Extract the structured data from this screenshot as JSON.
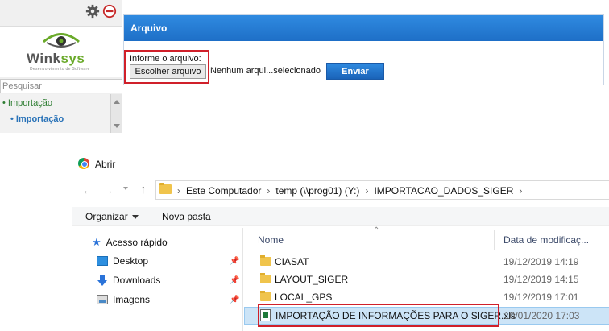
{
  "app": {
    "search_placeholder": "Pesquisar",
    "logo": {
      "word_part1": "Wink",
      "word_part2": "sys",
      "tagline": "Desenvolvimento de Software"
    },
    "menu": [
      {
        "label": "• Importação"
      },
      {
        "label": "• Importação"
      }
    ],
    "panel": {
      "title": "Arquivo",
      "file_label": "Informe o arquivo:",
      "choose_button": "Escolher arquivo",
      "file_status": "Nenhum arqui...selecionado",
      "send_button": "Enviar"
    }
  },
  "dialog": {
    "title": "Abrir",
    "breadcrumbs": [
      "Este Computador",
      "temp (\\\\prog01) (Y:)",
      "IMPORTACAO_DADOS_SIGER"
    ],
    "toolbar": {
      "organize": "Organizar",
      "new_folder": "Nova pasta"
    },
    "nav_pane": [
      {
        "label": "Acesso rápido",
        "icon": "star-icon"
      },
      {
        "label": "Desktop",
        "icon": "desktop-icon"
      },
      {
        "label": "Downloads",
        "icon": "downloads-icon"
      },
      {
        "label": "Imagens",
        "icon": "images-icon"
      }
    ],
    "columns": {
      "name": "Nome",
      "date": "Data de modificaç..."
    },
    "files": [
      {
        "name": "CIASAT",
        "date": "19/12/2019 14:19",
        "type": "folder"
      },
      {
        "name": "LAYOUT_SIGER",
        "date": "19/12/2019 14:15",
        "type": "folder"
      },
      {
        "name": "LOCAL_GPS",
        "date": "19/12/2019 17:01",
        "type": "folder"
      },
      {
        "name": "IMPORTAÇÃO DE INFORMAÇÕES PARA O SIGER.xls",
        "date": "10/01/2020 17:03",
        "type": "xls"
      }
    ]
  },
  "colors": {
    "header_blue": "#1e6fc7",
    "highlight_red": "#d0202a",
    "selected_row": "#cce4f7",
    "menu_green": "#2e7d32",
    "menu_blue": "#2a73b8"
  }
}
